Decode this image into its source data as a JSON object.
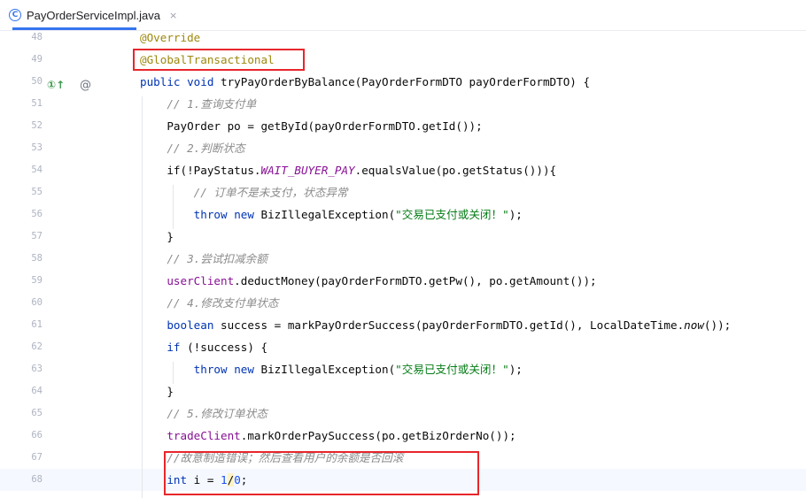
{
  "tab": {
    "icon": "class-icon",
    "label": "PayOrderServiceImpl.java",
    "close": "×"
  },
  "gutter_icons": {
    "implements": "①↑",
    "annotation": "@"
  },
  "lines": [
    {
      "n": "48",
      "tokens": [
        [
          "@Override",
          "ann"
        ]
      ]
    },
    {
      "n": "49",
      "tokens": [
        [
          "@GlobalTransactional",
          "ann"
        ]
      ]
    },
    {
      "n": "50",
      "tokens": [
        [
          "public",
          "kw"
        ],
        [
          " "
        ],
        [
          "void",
          "kw"
        ],
        [
          " tryPayOrderByBalance(PayOrderFormDTO payOrderFormDTO) {"
        ]
      ]
    },
    {
      "n": "51",
      "tokens": [
        [
          "    // 1.查询支付单",
          "cm"
        ]
      ]
    },
    {
      "n": "52",
      "tokens": [
        [
          "    PayOrder po = getById(payOrderFormDTO.getId());"
        ]
      ]
    },
    {
      "n": "53",
      "tokens": [
        [
          "    // 2.判断状态",
          "cm"
        ]
      ]
    },
    {
      "n": "54",
      "tokens": [
        [
          "    if(!PayStatus."
        ],
        [
          "WAIT_BUYER_PAY",
          "ic"
        ],
        [
          ".equalsValue(po.getStatus())){"
        ]
      ]
    },
    {
      "n": "55",
      "tokens": [
        [
          "        // 订单不是未支付，状态异常",
          "cm"
        ]
      ]
    },
    {
      "n": "56",
      "tokens": [
        [
          "        "
        ],
        [
          "throw",
          "kw"
        ],
        [
          " "
        ],
        [
          "new",
          "kw"
        ],
        [
          " BizIllegalException("
        ],
        [
          "\"交易已支付或关闭！\"",
          "str"
        ],
        [
          ");"
        ]
      ]
    },
    {
      "n": "57",
      "tokens": [
        [
          "    }"
        ]
      ]
    },
    {
      "n": "58",
      "tokens": [
        [
          "    // 3.尝试扣减余额",
          "cm"
        ]
      ]
    },
    {
      "n": "59",
      "tokens": [
        [
          "    "
        ],
        [
          "userClient",
          "fld"
        ],
        [
          ".deductMoney(payOrderFormDTO.getPw(), po.getAmount());"
        ]
      ]
    },
    {
      "n": "60",
      "tokens": [
        [
          "    // 4.修改支付单状态",
          "cm"
        ]
      ]
    },
    {
      "n": "61",
      "tokens": [
        [
          "    "
        ],
        [
          "boolean",
          "kw"
        ],
        [
          " success = markPayOrderSuccess(payOrderFormDTO.getId(), LocalDateTime."
        ],
        [
          "now",
          "it"
        ],
        [
          "());"
        ]
      ]
    },
    {
      "n": "62",
      "tokens": [
        [
          "    "
        ],
        [
          "if",
          "kw"
        ],
        [
          " (!success) {"
        ]
      ]
    },
    {
      "n": "63",
      "tokens": [
        [
          "        "
        ],
        [
          "throw",
          "kw"
        ],
        [
          " "
        ],
        [
          "new",
          "kw"
        ],
        [
          " BizIllegalException("
        ],
        [
          "\"交易已支付或关闭！\"",
          "str"
        ],
        [
          ");"
        ]
      ]
    },
    {
      "n": "64",
      "tokens": [
        [
          "    }"
        ]
      ]
    },
    {
      "n": "65",
      "tokens": [
        [
          "    // 5.修改订单状态",
          "cm"
        ]
      ]
    },
    {
      "n": "66",
      "tokens": [
        [
          "    "
        ],
        [
          "tradeClient",
          "fld"
        ],
        [
          ".markOrderPaySuccess(po.getBizOrderNo());"
        ]
      ]
    },
    {
      "n": "67",
      "tokens": [
        [
          "    //故意制造错误；然后查看用户的余额是否回滚",
          "cm"
        ]
      ]
    },
    {
      "n": "68",
      "tokens": [
        [
          "    "
        ],
        [
          "int",
          "kw"
        ],
        [
          " i = "
        ],
        [
          "1",
          "num"
        ],
        [
          "/",
          "caretch"
        ],
        [
          "0",
          "num"
        ],
        [
          ";"
        ]
      ]
    }
  ]
}
